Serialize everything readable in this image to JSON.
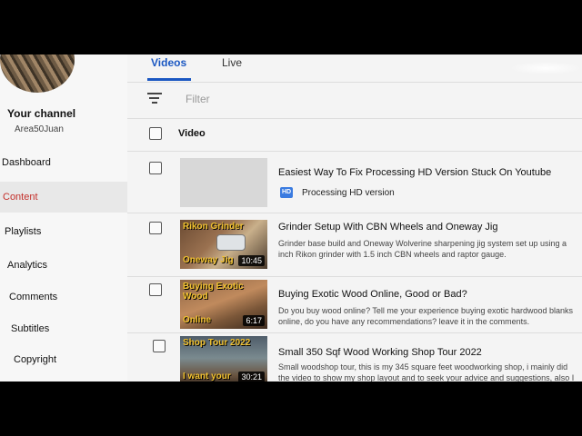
{
  "sidebar": {
    "channel_title": "Your channel",
    "channel_handle": "Area50Juan",
    "items": [
      {
        "label": "Dashboard"
      },
      {
        "label": "Content"
      },
      {
        "label": "Playlists"
      },
      {
        "label": "Analytics"
      },
      {
        "label": "Comments"
      },
      {
        "label": "Subtitles"
      },
      {
        "label": "Copyright"
      }
    ]
  },
  "tabs": [
    {
      "label": "Videos"
    },
    {
      "label": "Live"
    }
  ],
  "filter": {
    "placeholder": "Filter"
  },
  "table": {
    "column_video": "Video"
  },
  "videos": [
    {
      "title": "Easiest Way To Fix Processing HD Version Stuck On Youtube",
      "status_badge": "HD",
      "status_text": "Processing HD version"
    },
    {
      "title": "Grinder Setup With CBN Wheels and Oneway Jig",
      "desc1": "Grinder base build and Oneway Wolverine sharpening jig system set up using a",
      "desc2": "inch Rikon grinder with 1.5 inch CBN wheels and raptor gauge.",
      "thumb_top": "Rikon Grinder",
      "thumb_bottom": "Oneway Jig",
      "duration": "10:45"
    },
    {
      "title": "Buying Exotic Wood Online, Good or Bad?",
      "desc1": "Do you buy wood online? Tell me your experience buying exotic hardwood blanks",
      "desc2": "online, do you have any recommendations? leave it in the comments.",
      "thumb_top": "Buying Exotic Wood",
      "thumb_bottom": "Online",
      "duration": "6:17"
    },
    {
      "title": "Small 350 Sqf Wood Working Shop Tour 2022",
      "desc1": "Small woodshop tour, this is my 345 square feet woodworking shop, i mainly did",
      "desc2": "the video to show my shop layout and to seek your advice and suggestions, also I",
      "thumb_top": "Shop Tour 2022",
      "thumb_bottom": "I want your",
      "duration": "30:21"
    }
  ],
  "colors": {
    "accent_blue": "#1a57c2",
    "active_nav_red": "#c4302b",
    "hd_badge": "#3a7be0"
  }
}
